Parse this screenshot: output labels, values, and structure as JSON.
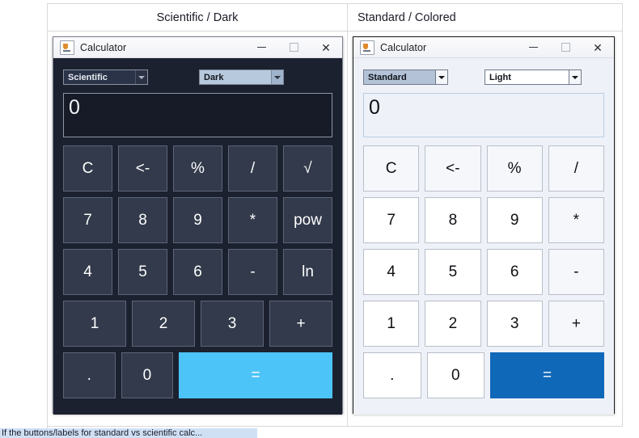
{
  "page": {
    "background": "#ffffff",
    "caption_clipped": "If the buttons/labels for standard vs scientific calc..."
  },
  "panels": [
    {
      "id": "scientific-dark",
      "header": "Scientific / Dark",
      "header_align": "center",
      "window": {
        "title": "Calculator",
        "icon": "java-coffee-cup-icon",
        "controls": {
          "minimize": "minimize-icon",
          "maximize": "maximize-icon",
          "close": "close-icon"
        }
      },
      "mode_select": {
        "value": "Scientific",
        "arrow": "chevron-down-icon"
      },
      "theme_select": {
        "value": "Dark",
        "arrow": "chevron-down-icon"
      },
      "display": {
        "value": "0"
      },
      "accent_color": "#4dc4f7",
      "keys": [
        [
          {
            "label": "C",
            "kind": "fn"
          },
          {
            "label": "<-",
            "kind": "fn"
          },
          {
            "label": "%",
            "kind": "op"
          },
          {
            "label": "/",
            "kind": "op"
          },
          {
            "label": "√",
            "kind": "op"
          }
        ],
        [
          {
            "label": "7",
            "kind": "num"
          },
          {
            "label": "8",
            "kind": "num"
          },
          {
            "label": "9",
            "kind": "num"
          },
          {
            "label": "*",
            "kind": "op"
          },
          {
            "label": "pow",
            "kind": "op"
          }
        ],
        [
          {
            "label": "4",
            "kind": "num"
          },
          {
            "label": "5",
            "kind": "num"
          },
          {
            "label": "6",
            "kind": "num"
          },
          {
            "label": "-",
            "kind": "op"
          },
          {
            "label": "ln",
            "kind": "op"
          }
        ],
        [
          {
            "label": "1",
            "kind": "num"
          },
          {
            "label": "2",
            "kind": "num"
          },
          {
            "label": "3",
            "kind": "num"
          },
          {
            "label": "+",
            "kind": "op"
          }
        ],
        [
          {
            "label": ".",
            "kind": "num"
          },
          {
            "label": "0",
            "kind": "num"
          },
          {
            "label": "=",
            "kind": "eq",
            "span": 3
          }
        ]
      ]
    },
    {
      "id": "standard-colored",
      "header": "Standard / Colored",
      "header_align": "left",
      "window": {
        "title": "Calculator",
        "icon": "java-coffee-cup-icon",
        "controls": {
          "minimize": "minimize-icon",
          "maximize": "maximize-icon",
          "close": "close-icon"
        }
      },
      "mode_select": {
        "value": "Standard",
        "arrow": "chevron-down-icon"
      },
      "theme_select": {
        "value": "Light",
        "arrow": "chevron-down-icon"
      },
      "display": {
        "value": "0"
      },
      "accent_color": "#1068b8",
      "keys": [
        [
          {
            "label": "C",
            "kind": "fn"
          },
          {
            "label": "<-",
            "kind": "fn"
          },
          {
            "label": "%",
            "kind": "op"
          },
          {
            "label": "/",
            "kind": "op"
          }
        ],
        [
          {
            "label": "7",
            "kind": "num"
          },
          {
            "label": "8",
            "kind": "num"
          },
          {
            "label": "9",
            "kind": "num"
          },
          {
            "label": "*",
            "kind": "op"
          }
        ],
        [
          {
            "label": "4",
            "kind": "num"
          },
          {
            "label": "5",
            "kind": "num"
          },
          {
            "label": "6",
            "kind": "num"
          },
          {
            "label": "-",
            "kind": "op"
          }
        ],
        [
          {
            "label": "1",
            "kind": "num"
          },
          {
            "label": "2",
            "kind": "num"
          },
          {
            "label": "3",
            "kind": "num"
          },
          {
            "label": "+",
            "kind": "op"
          }
        ],
        [
          {
            "label": ".",
            "kind": "num"
          },
          {
            "label": "0",
            "kind": "num"
          },
          {
            "label": "=",
            "kind": "eq",
            "span": 2
          }
        ]
      ]
    }
  ]
}
